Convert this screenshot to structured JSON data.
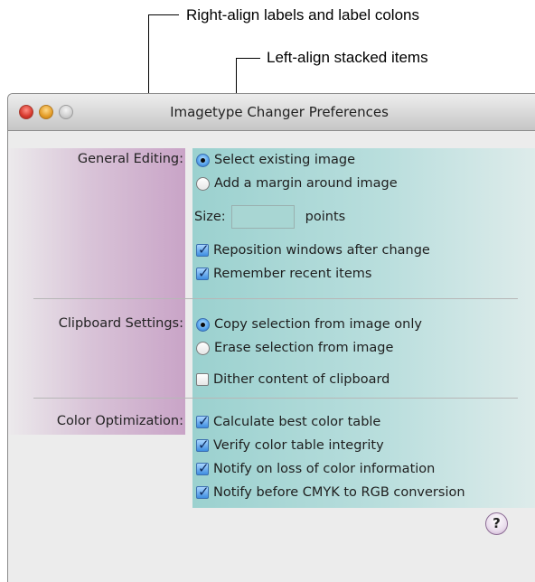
{
  "callouts": {
    "right_align": "Right-align labels and label colons",
    "left_align": "Left-align stacked items"
  },
  "window": {
    "title": "Imagetype Changer Preferences"
  },
  "general": {
    "label": "General Editing:",
    "select_existing": "Select existing image",
    "add_margin": "Add a margin around image",
    "size_label": "Size:",
    "size_value": "",
    "size_unit": "points",
    "reposition": "Reposition windows after change",
    "remember_recent": "Remember recent items"
  },
  "clipboard": {
    "label": "Clipboard Settings:",
    "copy_selection": "Copy selection from image only",
    "erase_selection": "Erase selection from image",
    "dither": "Dither content of clipboard"
  },
  "color": {
    "label": "Color Optimization:",
    "calculate_best": "Calculate best color table",
    "verify_integrity": "Verify color table integrity",
    "notify_loss": "Notify on loss of color information",
    "notify_cmyk": "Notify before CMYK to RGB conversion"
  },
  "help": {
    "glyph": "?"
  },
  "state": {
    "select_existing_selected": true,
    "add_margin_selected": false,
    "reposition_checked": true,
    "remember_recent_checked": true,
    "copy_selection_selected": true,
    "erase_selection_selected": false,
    "dither_checked": false,
    "calculate_best_checked": true,
    "verify_integrity_checked": true,
    "notify_loss_checked": true,
    "notify_cmyk_checked": true
  },
  "colors": {
    "label_band": "#c9a4c7",
    "items_band": "#9bd1cf",
    "window_bg": "#ececec"
  }
}
